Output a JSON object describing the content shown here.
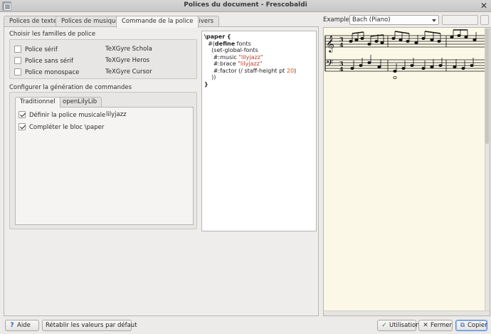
{
  "window": {
    "title": "Polices du document - Frescobaldi",
    "close_glyph": "✕"
  },
  "tabs": [
    {
      "label": "Polices de texte"
    },
    {
      "label": "Polices de musique"
    },
    {
      "label": "Commande de la police"
    },
    {
      "label": "Divers"
    }
  ],
  "families": {
    "title": "Choisir les familles de police",
    "rows": [
      {
        "label": "Police sérif",
        "font": "TeXGyre Schola",
        "checked": false
      },
      {
        "label": "Police sans sérif",
        "font": "TeXGyre Heros",
        "checked": false
      },
      {
        "label": "Police monospace",
        "font": "TeXGyre Cursor",
        "checked": false
      }
    ]
  },
  "generation": {
    "title": "Configurer la génération de commandes",
    "subtabs": [
      {
        "label": "Traditionnel"
      },
      {
        "label": "openLilyLib"
      }
    ],
    "options": [
      {
        "label": "Définir la police musicale",
        "value": "lilyjazz",
        "checked": true
      },
      {
        "label": "Compléter le bloc \\paper",
        "value": "",
        "checked": true
      }
    ]
  },
  "code": {
    "l1": "\\paper {",
    "l2a": "  #(",
    "l2b": "define",
    "l2c": " fonts",
    "l3": "    (set-global-fonts",
    "l4a": "     #:music ",
    "l4b": "\"lilyjazz\"",
    "l5a": "     #:brace ",
    "l5b": "\"lilyjazz\"",
    "l6a": "     #:factor (/ staff-height pt ",
    "l6b": "20",
    "l6c": ")",
    "l7": "    ))",
    "l8": "}"
  },
  "example": {
    "label": "Example:",
    "selected": "Bach (Piano)"
  },
  "preview": {
    "score": "Bach (Piano)"
  },
  "buttons": {
    "help": "Aide",
    "reset": "Rétablir les valeurs par défaut",
    "use": "Utilisation",
    "close": "Fermer",
    "copy": "Copier"
  },
  "colors": {
    "accent": "#5b8dd6",
    "string": "#c0392b",
    "number": "#d35400",
    "preview_bg": "#fbf8e7"
  }
}
